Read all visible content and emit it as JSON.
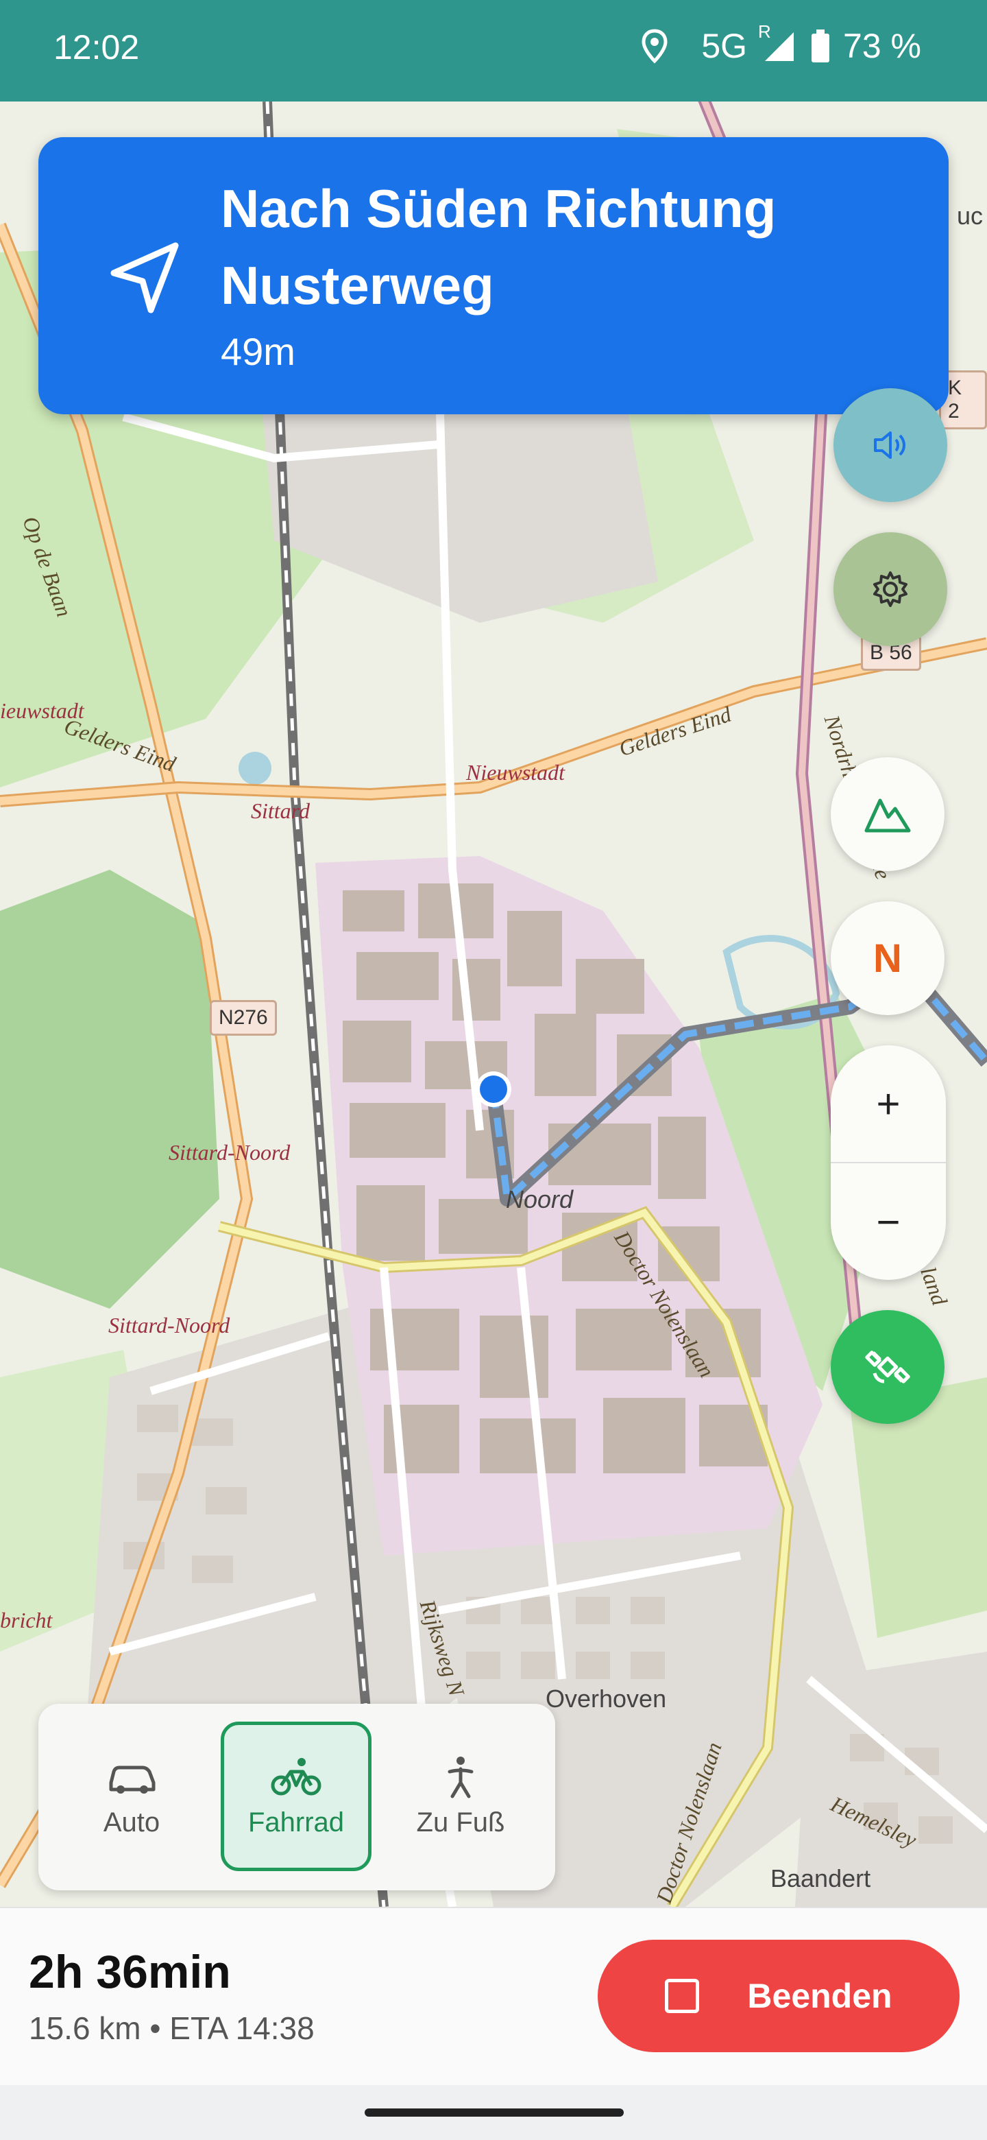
{
  "status_bar": {
    "time": "12:02",
    "network": "5G",
    "roaming": "R",
    "battery": "73 %",
    "icons": [
      "location-icon",
      "signal-icon",
      "battery-icon"
    ]
  },
  "instruction": {
    "title": "Nach Süden Richtung Nusterweg",
    "distance": "49m",
    "icon": "navigation-arrow-icon"
  },
  "map_labels": {
    "op_de_baan": "Op de Baan",
    "nieuwstadt_left": "ieuwstadt",
    "gelders_eind_left": "Gelders Eind",
    "gelders_eind_right": "Gelders Eind",
    "sittard_top": "Sittard",
    "nieuwstadt_center": "Nieuwstadt",
    "n276": "N276",
    "b56": "B 56",
    "k2": "K 2",
    "nordrhein": "Nordrhein-Westfale",
    "sittard_noord_1": "Sittard-Noord",
    "sittard_noord_2": "Sittard-Noord",
    "noord": "Noord",
    "doctor_nolenslaan_1": "Doctor Nolenslaan",
    "doctor_nolenslaan_2": "Doctor Nolenslaan",
    "rijksweg": "Rijksweg N",
    "overhoven": "Overhoven",
    "hemelsley": "Hemelsley",
    "baandert": "Baandert",
    "bricht": "bricht",
    "uc": "uc",
    "land": "land"
  },
  "controls": {
    "compass_label": "N",
    "zoom_in": "+",
    "zoom_out": "−",
    "sound_icon": "volume-icon",
    "settings_icon": "gear-icon",
    "terrain_icon": "mountain-icon",
    "recenter_icon": "satellite-icon"
  },
  "modes": [
    {
      "label": "Auto",
      "icon": "car-icon",
      "active": false
    },
    {
      "label": "Fahrrad",
      "icon": "bicycle-icon",
      "active": true
    },
    {
      "label": "Zu Fuß",
      "icon": "walking-icon",
      "active": false
    }
  ],
  "trip": {
    "duration": "2h 36min",
    "info": "15.6 km • ETA 14:38",
    "end_label": "Beenden"
  },
  "colors": {
    "status_bar": "#2e968c",
    "instruction_bg": "#1a73e8",
    "active_mode": "#1f9a5a",
    "end_button": "#ee4444",
    "route": "#6aaef0"
  }
}
